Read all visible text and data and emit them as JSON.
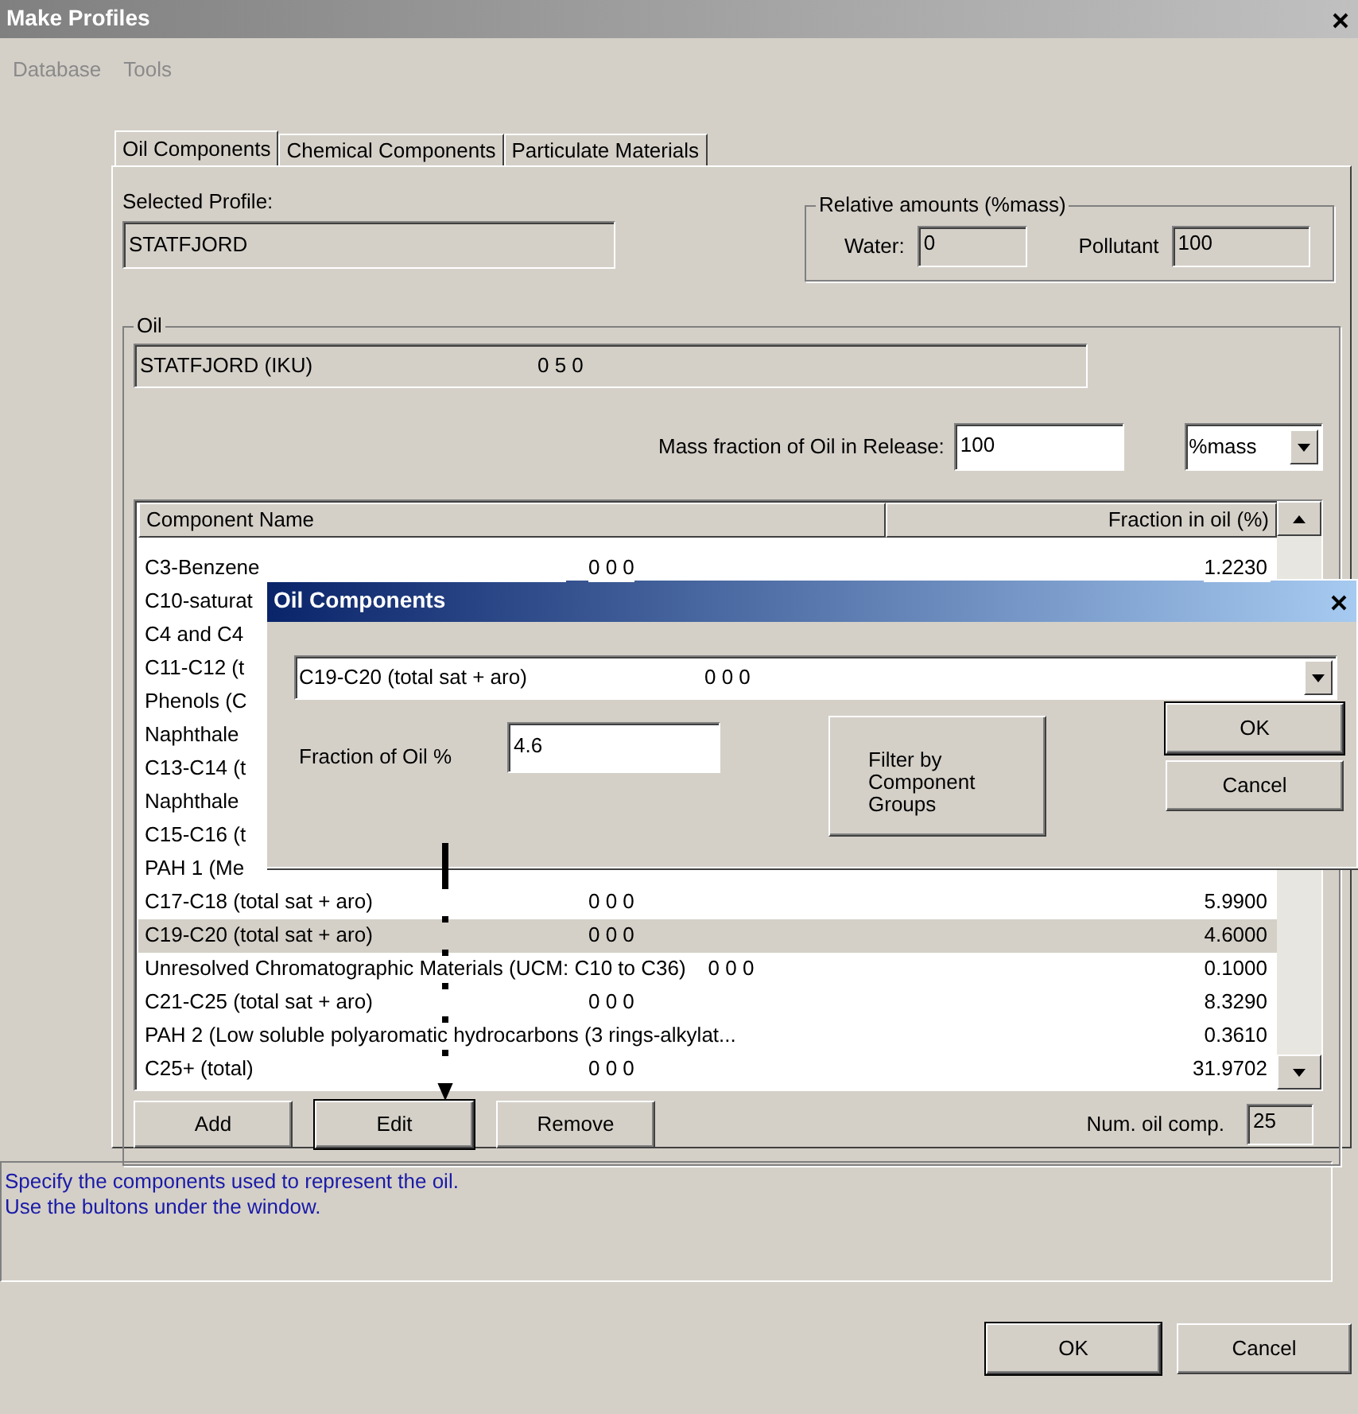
{
  "window": {
    "title": "Make Profiles"
  },
  "menu": [
    {
      "label": "Database",
      "disabled": true
    },
    {
      "label": "Tools",
      "disabled": true
    }
  ],
  "tabs": [
    {
      "label": "Oil Components",
      "selected": true
    },
    {
      "label": "Chemical Components",
      "selected": false
    },
    {
      "label": "Particulate Materials",
      "selected": false
    }
  ],
  "selected_profile": {
    "label": "Selected Profile:",
    "value": "STATFJORD"
  },
  "relative_amounts": {
    "title": "Relative amounts (%mass)",
    "water_label": "Water:",
    "water_value": "0",
    "pollutant_label": "Pollutant",
    "pollutant_value": "100"
  },
  "oil": {
    "title": "Oil",
    "name": "STATFJORD (IKU)",
    "code": "0 5 0",
    "mass_fraction_label": "Mass fraction of Oil in Release:",
    "mass_fraction_value": "100",
    "unit": "%mass"
  },
  "components": {
    "columns": [
      "Component Name",
      "Fraction in oil (%)"
    ],
    "rows": [
      {
        "name": "C3-Benzene",
        "code": "0 0 0",
        "fraction": "1.2230",
        "selected": false
      },
      {
        "name": "C10-saturat",
        "selected": false
      },
      {
        "name": "C4 and C4",
        "selected": false
      },
      {
        "name": "C11-C12 (t",
        "selected": false
      },
      {
        "name": "Phenols (C",
        "selected": false
      },
      {
        "name": "Naphthale",
        "selected": false
      },
      {
        "name": "C13-C14 (t",
        "selected": false
      },
      {
        "name": "Naphthale",
        "selected": false
      },
      {
        "name": "C15-C16 (t",
        "selected": false
      },
      {
        "name": "PAH 1 (Me",
        "selected": false
      },
      {
        "name": "C17-C18 (total sat + aro)",
        "code": "0 0 0",
        "fraction": "5.9900",
        "selected": false
      },
      {
        "name": "C19-C20 (total sat + aro)",
        "code": "0 0 0",
        "fraction": "4.6000",
        "selected": true
      },
      {
        "name": "Unresolved Chromatographic Materials (UCM: C10 to C36)",
        "code": "0 0 0",
        "fraction": "0.1000",
        "selected": false
      },
      {
        "name": "C21-C25 (total sat + aro)",
        "code": "0 0 0",
        "fraction": "8.3290",
        "selected": false
      },
      {
        "name": "PAH 2 (Low soluble polyaromatic hydrocarbons (3 rings-alkylat...",
        "fraction": "0.3610",
        "selected": false
      },
      {
        "name": "C25+ (total)",
        "code": "0 0 0",
        "fraction": "31.9702",
        "selected": false
      }
    ]
  },
  "list_buttons": [
    {
      "label": "Add",
      "default": false
    },
    {
      "label": "Edit",
      "default": true
    },
    {
      "label": "Remove",
      "default": false
    }
  ],
  "num_components": {
    "label": "Num. oil comp.",
    "value": "25"
  },
  "help": [
    "Specify the components used to represent the oil.",
    "Use the bultons under the window."
  ],
  "footer_buttons": [
    {
      "label": "OK",
      "default": true
    },
    {
      "label": "Cancel",
      "default": false
    }
  ],
  "dialog": {
    "title": "Oil Components",
    "component": "C19-C20 (total sat + aro)",
    "component_code": "0 0 0",
    "fraction_label": "Fraction of Oil %",
    "fraction_value": "4.6",
    "filter_button": "Filter by Component Groups",
    "buttons": [
      {
        "label": "OK",
        "default": true
      },
      {
        "label": "Cancel",
        "default": false
      }
    ]
  }
}
